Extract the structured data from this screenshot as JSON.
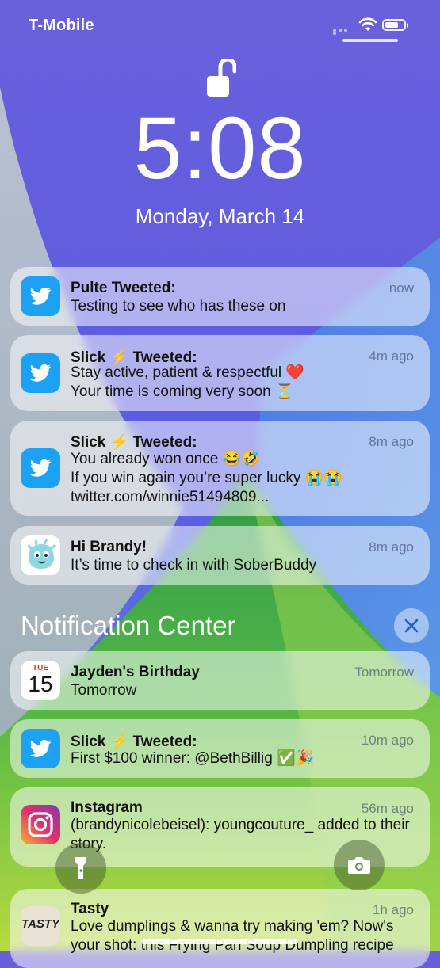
{
  "status_bar": {
    "carrier": "T-Mobile",
    "wifi_icon": "wifi-icon",
    "battery_icon": "battery-icon"
  },
  "lock_screen": {
    "lock_icon": "unlocked-padlock-icon",
    "time": "5:08",
    "date": "Monday, March 14"
  },
  "notifications": [
    {
      "app": "Twitter",
      "icon": "twitter-icon",
      "title": "Pulte Tweeted:",
      "body": "Testing to see who has these on",
      "time": "now"
    },
    {
      "app": "Twitter",
      "icon": "twitter-icon",
      "title": "Slick ⚡️ Tweeted:",
      "body": "Stay active, patient & respectful ❤️\nYour time is coming very soon ⏳",
      "time": "4m ago"
    },
    {
      "app": "Twitter",
      "icon": "twitter-icon",
      "title": "Slick ⚡️ Tweeted:",
      "body": "You already won once 😂🤣\nIf you win again you’re super lucky 😭😭\ntwitter.com/winnie51494809...",
      "time": "8m ago"
    },
    {
      "app": "SoberBuddy",
      "icon": "soberbuddy-icon",
      "title": "Hi Brandy!",
      "body": "It’s time to check in with SoberBuddy",
      "time": "8m ago"
    }
  ],
  "notification_center": {
    "title": "Notification Center",
    "close_icon": "close-icon",
    "items": [
      {
        "app": "Calendar",
        "icon": "calendar-icon",
        "icon_day": "TUE",
        "icon_date": "15",
        "title": "Jayden's Birthday",
        "body": "Tomorrow",
        "time": "Tomorrow"
      },
      {
        "app": "Twitter",
        "icon": "twitter-icon",
        "title": "Slick ⚡️ Tweeted:",
        "body": "First $100 winner: @BethBillig ✅🎉",
        "time": "10m ago"
      },
      {
        "app": "Instagram",
        "icon": "instagram-icon",
        "title": "Instagram",
        "body": "(brandynicolebeisel): youngcouture_ added to their story.",
        "time": "56m ago"
      },
      {
        "app": "Tasty",
        "icon": "tasty-icon",
        "icon_text": "TASTY",
        "title": "Tasty",
        "body": "Love dumplings & wanna try making 'em? Now's your shot: this Frying Pan Soup Dumpling recipe",
        "time": "1h ago"
      }
    ]
  },
  "quick_actions": {
    "flashlight_icon": "flashlight-icon",
    "camera_icon": "camera-icon"
  },
  "colors": {
    "twitter_blue": "#1DA1F2",
    "calendar_red": "#E0332B",
    "accent_wallpaper": "#6a5fd8"
  }
}
